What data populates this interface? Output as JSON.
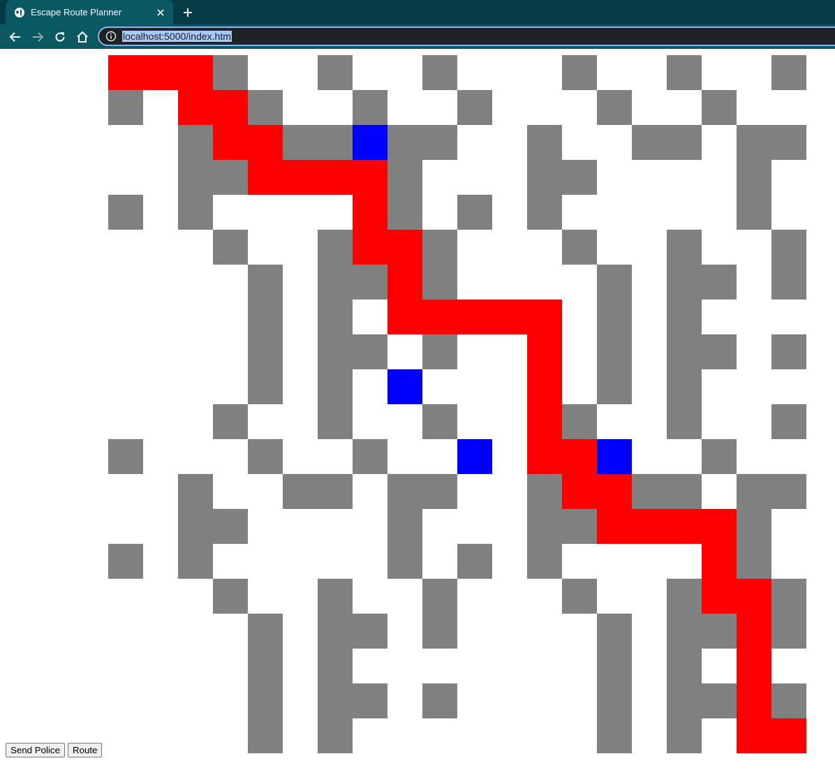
{
  "browser": {
    "tab_title": "Escape Route Planner",
    "url": "localhost:5000/index.htm",
    "colors": {
      "frame": "#053b45",
      "toolbar": "#0a5862",
      "omnibox": "#202124",
      "selection": "#a8c7fa"
    }
  },
  "grid": {
    "rows": 20,
    "cols": 20,
    "legend": {
      "W": "empty",
      "G": "wall",
      "R": "route",
      "B": "police"
    },
    "colors": {
      "W": "#ffffff",
      "G": "#808080",
      "R": "#ff0000",
      "B": "#0000ff"
    },
    "cells": [
      "RRRGWWGWWGWWWGWWGWWG",
      "GWRRGWWGWWGWWWGWWGWW",
      "WWGRRGGBGGWWGWWGGWGG",
      "WWGGRRRRGWWWGGWWWWGW",
      "GWGWWWWRGWGWGWWWWWGW",
      "WWWGWWGRRGWWWGWWGWWG",
      "WWWWGWGGRGWWWWGWGGWG",
      "WWWWGWGWRRRRRWGWGWWW",
      "WWWWGWGGWGWWRWGWGGWG",
      "WWWWGWGWBWWWRWGWGWWW",
      "WWWGWWGWWGWWRGWWGWWG",
      "GWWWGWWGWWBWRRBWWGWW",
      "WWGWWGGWGGWWGRRGGWGG",
      "WWGGWWWWGWWWGGRRRRGW",
      "GWGWWWWWGWGWGWWWWRGW",
      "WWWGWWGWWGWWWGWWGRRG",
      "WWWWGWGGWGWWWWGWGGRG",
      "WWWWGWGWWWWWWWGWGWRW",
      "WWWWGWGGWGWWWWGWGGRG",
      "WWWWGWGWWWWWWWGWGWRR"
    ]
  },
  "controls": {
    "send_police_label": "Send Police",
    "route_label": "Route"
  }
}
